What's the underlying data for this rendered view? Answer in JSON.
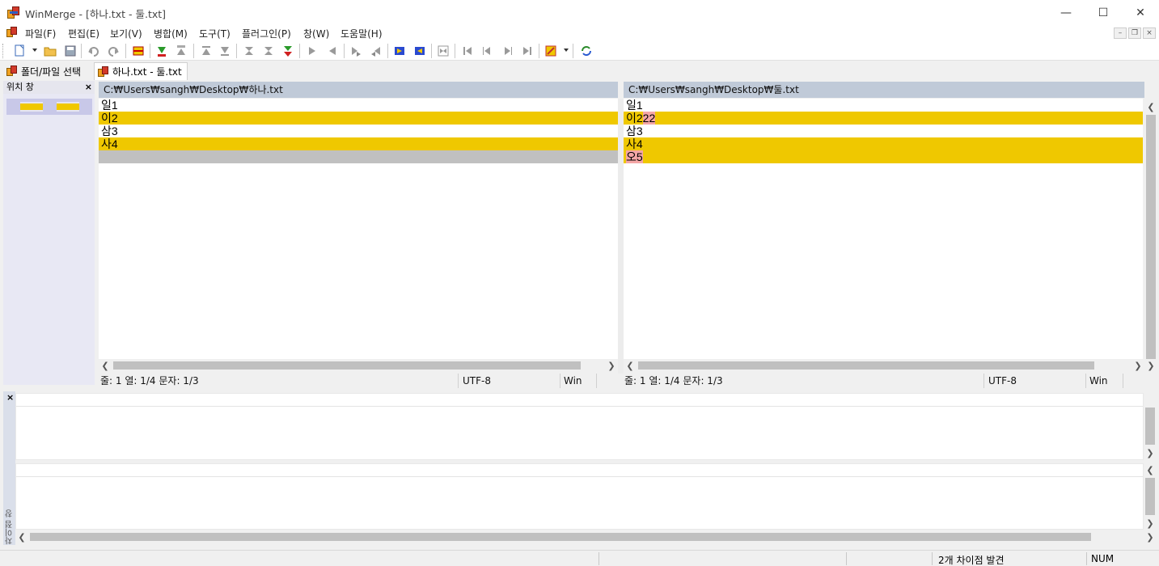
{
  "window": {
    "title": "WinMerge - [하나.txt - 둘.txt]",
    "minimize_glyph": "—",
    "maximize_glyph": "☐",
    "close_glyph": "✕"
  },
  "menu": {
    "items": [
      "파일(F)",
      "편집(E)",
      "보기(V)",
      "병합(M)",
      "도구(T)",
      "플러그인(P)",
      "창(W)",
      "도움말(H)"
    ],
    "mdi_minimize": "–",
    "mdi_restore": "❐",
    "mdi_close": "×"
  },
  "toolbar": {
    "icons": [
      "new-document-icon",
      "open-folder-icon",
      "save-icon",
      "undo-icon",
      "redo-icon",
      "rescan-icon",
      "next-diff-icon",
      "prev-diff-icon",
      "first-diff-icon",
      "last-diff-icon",
      "current-diff-icon",
      "next-conflict-icon",
      "copy-right-icon",
      "copy-left-icon",
      "copy-right-advance-icon",
      "copy-left-advance-icon",
      "copy-all-right-icon",
      "copy-all-left-icon",
      "merge-mode-icon",
      "first-file-icon",
      "prev-file-icon",
      "next-file-icon",
      "last-file-icon",
      "options-icon",
      "refresh-icon"
    ]
  },
  "tabs": [
    {
      "label": "폴더/파일 선택",
      "active": false
    },
    {
      "label": "하나.txt - 둘.txt",
      "active": true
    }
  ],
  "location_pane": {
    "title": "위치 창",
    "close": "×"
  },
  "left": {
    "path": "C:₩Users₩sangh₩Desktop₩하나.txt",
    "lines": [
      {
        "text": "일1",
        "type": "same"
      },
      {
        "text": "이2",
        "type": "diff"
      },
      {
        "text": "삼3",
        "type": "same"
      },
      {
        "text": "사4",
        "type": "diff"
      },
      {
        "text": "",
        "type": "empty"
      }
    ],
    "status": {
      "line_col": "줄: 1   열: 1/4   문자: 1/3",
      "encoding": "UTF-8",
      "eol": "Win"
    }
  },
  "right": {
    "path": "C:₩Users₩sangh₩Desktop₩둘.txt",
    "lines": [
      {
        "text": "일1",
        "type": "same"
      },
      {
        "pre": "이2",
        "hl": "22",
        "type": "diff"
      },
      {
        "text": "삼3",
        "type": "same"
      },
      {
        "pre": "사4",
        "hl": "",
        "type": "diff"
      },
      {
        "pre": "",
        "hl": "오5",
        "type": "diff"
      }
    ],
    "status": {
      "line_col": "줄: 1   열: 1/4   문자: 1/3",
      "encoding": "UTF-8",
      "eol": "Win"
    }
  },
  "diff_pane": {
    "close": "×",
    "label": "차이점 창"
  },
  "statusbar": {
    "diff_count": "2개 차이점 발견",
    "num": "NUM"
  },
  "colors": {
    "diff": "#efc800",
    "word_diff": "#f4a6a6",
    "missing": "#c0c0c0",
    "header": "#c0cad8"
  }
}
